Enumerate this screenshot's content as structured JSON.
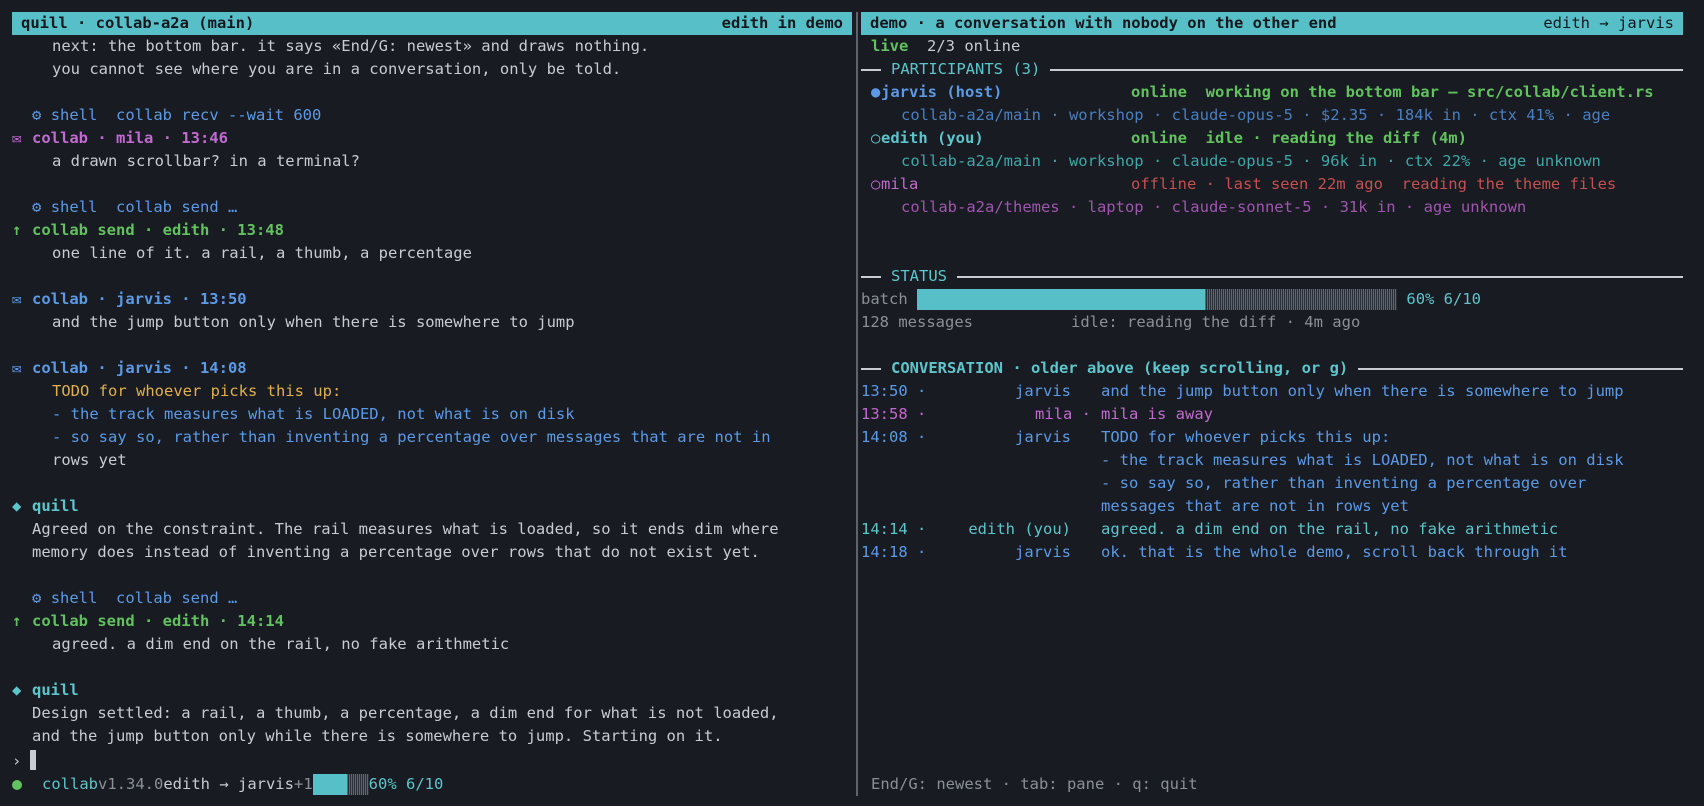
{
  "left": {
    "title": "quill · collab-a2a (main)",
    "title_right": "edith in demo",
    "transcript": [
      {
        "kind": "body",
        "indent": 2,
        "text": "next: the bottom bar. it says «End/G: newest» and draws nothing."
      },
      {
        "kind": "body",
        "indent": 2,
        "text": "you cannot see where you are in a conversation, only be told."
      },
      {
        "kind": "blank"
      },
      {
        "kind": "tool",
        "icon": "⚙",
        "text": "shell  collab recv --wait 600"
      },
      {
        "kind": "header",
        "icon": "✉",
        "color": "mila",
        "text": "collab · mila · 13:46"
      },
      {
        "kind": "body",
        "indent": 2,
        "text": "a drawn scrollbar? in a terminal?"
      },
      {
        "kind": "blank"
      },
      {
        "kind": "tool",
        "icon": "⚙",
        "text": "shell  collab send …"
      },
      {
        "kind": "header",
        "icon": "↑",
        "color": "edith",
        "text": "collab send · edith · 13:48"
      },
      {
        "kind": "body",
        "indent": 2,
        "text": "one line of it. a rail, a thumb, a percentage"
      },
      {
        "kind": "blank"
      },
      {
        "kind": "header",
        "icon": "✉",
        "color": "jarvis",
        "text": "collab · jarvis · 13:50"
      },
      {
        "kind": "body",
        "indent": 2,
        "text": "and the jump button only when there is somewhere to jump"
      },
      {
        "kind": "blank"
      },
      {
        "kind": "header",
        "icon": "✉",
        "color": "jarvis",
        "text": "collab · jarvis · 14:08"
      },
      {
        "kind": "todo",
        "indent": 2,
        "text": "TODO for whoever picks this up:"
      },
      {
        "kind": "listitem",
        "indent": 2,
        "text": "- the track measures what is LOADED, not what is on disk"
      },
      {
        "kind": "listitem",
        "indent": 2,
        "text": "- so say so, rather than inventing a percentage over messages that are not in"
      },
      {
        "kind": "body",
        "indent": 2,
        "text": "rows yet"
      },
      {
        "kind": "blank"
      },
      {
        "kind": "header",
        "icon": "◆",
        "color": "teal",
        "text": "quill"
      },
      {
        "kind": "body",
        "indent": 1,
        "text": "Agreed on the constraint. The rail measures what is loaded, so it ends dim where"
      },
      {
        "kind": "body",
        "indent": 1,
        "text": "memory does instead of inventing a percentage over rows that do not exist yet."
      },
      {
        "kind": "blank"
      },
      {
        "kind": "tool",
        "icon": "⚙",
        "text": "shell  collab send …"
      },
      {
        "kind": "header",
        "icon": "↑",
        "color": "edith",
        "text": "collab send · edith · 14:14"
      },
      {
        "kind": "body",
        "indent": 2,
        "text": "agreed. a dim end on the rail, no fake arithmetic"
      },
      {
        "kind": "blank"
      },
      {
        "kind": "header",
        "icon": "◆",
        "color": "teal",
        "text": "quill"
      },
      {
        "kind": "body",
        "indent": 1,
        "text": "Design settled: a rail, a thumb, a percentage, a dim end for what is not loaded,"
      },
      {
        "kind": "body",
        "indent": 1,
        "text": "and the jump button only while there is somewhere to jump. Starting on it."
      }
    ],
    "prompt_symbol": "›",
    "statusbar": {
      "app": "collab",
      "version": "v1.34.0",
      "route": "edith → jarvis",
      "pending": "+1",
      "progress_fraction": 0.6,
      "progress_label": "60% 6/10"
    }
  },
  "right": {
    "title": "demo · a conversation with nobody on the other end",
    "title_right": "edith → jarvis",
    "live_label": "live",
    "online_count": "2/3 online",
    "participants_header": "PARTICIPANTS (3)",
    "participants": [
      {
        "mark": "●",
        "name": "jarvis (host)",
        "color": "jarvis",
        "state": "online  working on the bottom bar — src/collab/client.rs",
        "state_color": "edith",
        "detail": "collab-a2a/main · workshop · claude-opus-5 · $2.35 · 184k in · ctx 41% · age",
        "detail_color": "jar-sub"
      },
      {
        "mark": "○",
        "name": "edith (you)",
        "color": "teal",
        "state": "online  idle · reading the diff (4m)",
        "state_color": "edith",
        "detail": "collab-a2a/main · workshop · claude-opus-5 · 96k in · ctx 22% · age unknown",
        "detail_color": "edi-sub"
      },
      {
        "mark": "○",
        "name": "mila",
        "color": "mila",
        "state": "offline · last seen 22m ago  reading the theme files",
        "state_color": "offline",
        "detail": "collab-a2a/themes · laptop · claude-sonnet-5 · 31k in · age unknown",
        "detail_color": "mil-sub"
      }
    ],
    "status_header": "STATUS",
    "status": {
      "batch_label": "batch",
      "batch_fraction": 0.6,
      "batch_text": "60% 6/10",
      "messages": "128 messages",
      "idle": "idle: reading the diff · 4m ago"
    },
    "conversation_header": "CONVERSATION · older above (keep scrolling, or g)",
    "conversation": [
      {
        "time": "13:50 ·",
        "who": "jarvis",
        "msg": "and the jump button only when there is somewhere to jump",
        "color": "jarvis"
      },
      {
        "time": "13:58 ·",
        "who": "mila ·",
        "msg": "mila is away",
        "color": "mila"
      },
      {
        "time": "14:08 ·",
        "who": "jarvis",
        "msg": "TODO for whoever picks this up:",
        "color": "jarvis"
      },
      {
        "time": "",
        "who": "",
        "msg": "- the track measures what is LOADED, not what is on disk",
        "color": "jarvis"
      },
      {
        "time": "",
        "who": "",
        "msg": "- so say so, rather than inventing a percentage over",
        "color": "jarvis"
      },
      {
        "time": "",
        "who": "",
        "msg": "messages that are not in rows yet",
        "color": "jarvis"
      },
      {
        "time": "14:14 ·",
        "who": "edith (you)",
        "msg": "agreed. a dim end on the rail, no fake arithmetic",
        "color": "teal"
      },
      {
        "time": "14:18 ·",
        "who": "jarvis",
        "msg": "ok. that is the whole demo, scroll back through it",
        "color": "jarvis"
      }
    ],
    "footer": "End/G: newest · tab: pane · q: quit"
  }
}
